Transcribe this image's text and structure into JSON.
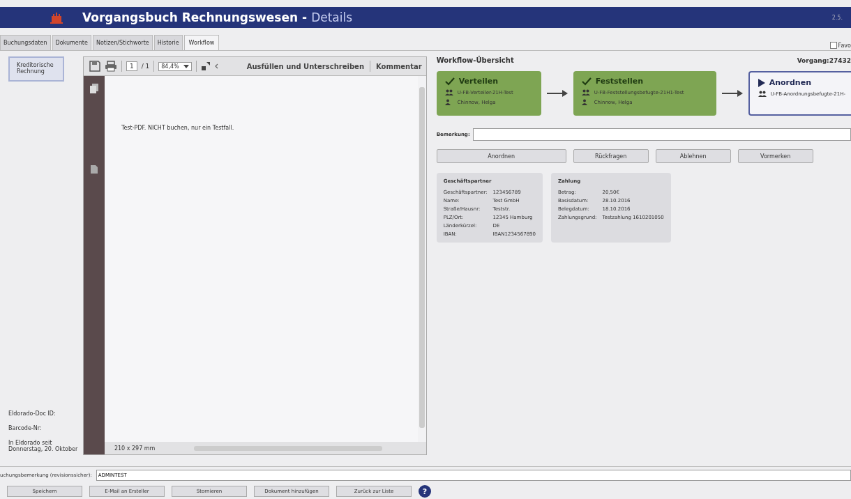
{
  "window": {
    "title": "Vorgangsbuch Rechnungswesen",
    "separator": "-",
    "subtitle": "Details",
    "version": "2.5.",
    "favorite": {
      "label": "Favo",
      "checked": false
    }
  },
  "tabs": [
    {
      "label": "Buchungsdaten",
      "selected": false
    },
    {
      "label": "Dokumente",
      "selected": false
    },
    {
      "label": "Notizen/Stichworte",
      "selected": false
    },
    {
      "label": "Historie",
      "selected": false
    },
    {
      "label": "Workflow",
      "selected": true
    }
  ],
  "sidebar": {
    "items": [
      {
        "label": "Kreditorische Rechnung",
        "selected": true
      }
    ],
    "info": [
      "Eldorado-Doc ID:",
      "Barcode-Nr:",
      "In Eldorado seit\nDonnerstag, 20. Oktober"
    ]
  },
  "pdf_viewer": {
    "page": "1",
    "page_count": "/ 1",
    "zoom": "84,4%",
    "fill_sign": "Ausfüllen und Unterschreiben",
    "comment": "Kommentar",
    "page_text": "Test-PDF. NICHT buchen, nur ein Testfall.",
    "page_size": "210 x 297 mm"
  },
  "workflow": {
    "title": "Workflow-Übersicht",
    "case": "Vorgang:27432",
    "steps": [
      {
        "name": "Verteilen",
        "kind": "done",
        "group": "U-FB-Verteiler-21H-Test",
        "user": "Chinnow, Helga"
      },
      {
        "name": "Feststellen",
        "kind": "done",
        "group": "U-FB-Feststellungsbefugte-21H1-Test",
        "user": "Chinnow, Helga"
      },
      {
        "name": "Anordnen",
        "kind": "current",
        "group": "U-FB-Anordnungsbefugte-21H-"
      }
    ],
    "remark": {
      "label": "Bemerkung:"
    },
    "buttons": [
      "Anordnen",
      "Rückfragen",
      "Ablehnen",
      "Vormerken"
    ],
    "cards": [
      {
        "title": "Geschäftspartner",
        "rows": [
          [
            "Geschäftspartner:",
            "123456789"
          ],
          [
            "Name:",
            "Test GmbH"
          ],
          [
            "Straße/Hausnr:",
            "Teststr."
          ],
          [
            "PLZ/Ort:",
            "12345 Hamburg"
          ],
          [
            "Länderkürzel:",
            "DE"
          ],
          [
            "IBAN:",
            "IBAN1234567890"
          ]
        ]
      },
      {
        "title": "Zahlung",
        "rows": [
          [
            "Betrag:",
            "20,50€"
          ],
          [
            "Basisdatum:",
            "28.10.2016"
          ],
          [
            "Belegdatum:",
            "18.10.2016"
          ],
          [
            "Zahlungsgrund:",
            "Testzahlung 1610201050"
          ]
        ]
      }
    ]
  },
  "booking_remark": {
    "label": "uchungsbemerkung (revisionssicher):",
    "value": "ADMINTEST"
  },
  "buttons": [
    "Speichern",
    "E-Mail an Ersteller",
    "Stornieren",
    "Dokument hinzufügen",
    "Zurück zur Liste"
  ],
  "help": "?"
}
